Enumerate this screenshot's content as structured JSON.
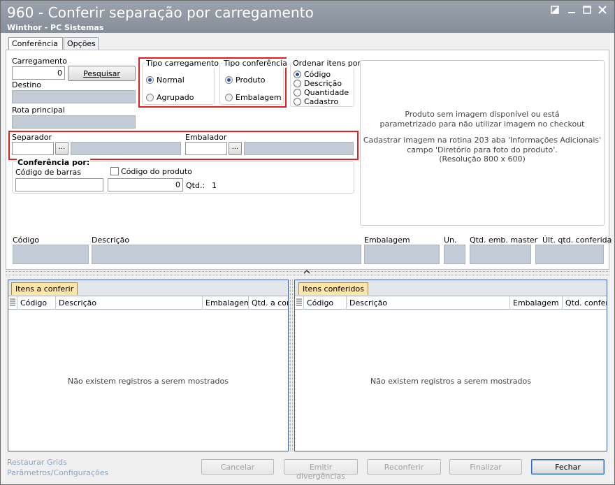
{
  "window": {
    "title": "960 - Conferir separação por carregamento",
    "subtitle": "Winthor - PC Sistemas",
    "controls": [
      "restore",
      "minimize",
      "maximize",
      "close"
    ]
  },
  "tabs": [
    {
      "label": "Conferência",
      "active": true
    },
    {
      "label": "Opções",
      "active": false
    }
  ],
  "form": {
    "carregamento_label": "Carregamento",
    "carregamento_value": "0",
    "pesquisar_label": "Pesquisar",
    "destino_label": "Destino",
    "destino_value": "",
    "rota_label": "Rota principal",
    "rota_value": "",
    "separador_label": "Separador",
    "embalador_label": "Embalador",
    "browse_label": "...",
    "conferencia_por_label": "Conferência por:",
    "codigo_barras_label": "Código de barras",
    "codigo_barras_value": "",
    "codigo_produto_label": "Código do produto",
    "codigo_produto_checked": false,
    "qty_value": "0",
    "qtd_label": "Qtd.:",
    "qtd_value": "1"
  },
  "tipo_carregamento": {
    "legend": "Tipo carregamento",
    "options": [
      {
        "label": "Normal",
        "selected": true
      },
      {
        "label": "Agrupado",
        "selected": false
      }
    ]
  },
  "tipo_conferencia": {
    "legend": "Tipo conferência",
    "options": [
      {
        "label": "Produto",
        "selected": true
      },
      {
        "label": "Embalagem",
        "selected": false
      }
    ]
  },
  "ordenar": {
    "legend": "Ordenar itens por",
    "options": [
      {
        "label": "Código",
        "selected": true
      },
      {
        "label": "Descrição",
        "selected": false
      },
      {
        "label": "Quantidade",
        "selected": false
      },
      {
        "label": "Cadastro",
        "selected": false
      }
    ]
  },
  "image_panel": {
    "line1": "Produto sem imagem disponível ou está",
    "line2": "parametrizado para não utilizar imagem no checkout",
    "line3": "Cadastrar imagem na rotina 203 aba 'Informações Adicionais'",
    "line4": "campo 'Diretório para foto do produto'.",
    "line5": "(Resolução 800 x 600)"
  },
  "detail": {
    "codigo_label": "Código",
    "descricao_label": "Descrição",
    "embalagem_label": "Embalagem",
    "un_label": "Un.",
    "qtd_master_label": "Qtd. emb. master",
    "ult_qtd_label": "Últ. qtd. conferida"
  },
  "grid_left": {
    "tab": "Itens a conferir",
    "columns": [
      "Código",
      "Descrição",
      "Embalagem",
      "Qtd. a cor"
    ],
    "empty": "Não existem registros a serem mostrados"
  },
  "grid_right": {
    "tab": "Itens conferidos",
    "columns": [
      "Código",
      "Descrição",
      "Embalagem",
      "Qtd. confer"
    ],
    "empty": "Não existem registros a serem mostrados"
  },
  "footer": {
    "restaurar": "Restaurar Grids",
    "parametros": "Parâmetros/Configurações",
    "cancelar": "Cancelar",
    "emitir": "Emitir divergências",
    "reconferir": "Reconferir",
    "finalizar": "Finalizar",
    "fechar": "Fechar"
  },
  "colors": {
    "titlebar": "#8d96a0",
    "highlight": "#e0201c",
    "grid_border": "#3d5fa8",
    "grid_tab": "#ffe6a8"
  }
}
